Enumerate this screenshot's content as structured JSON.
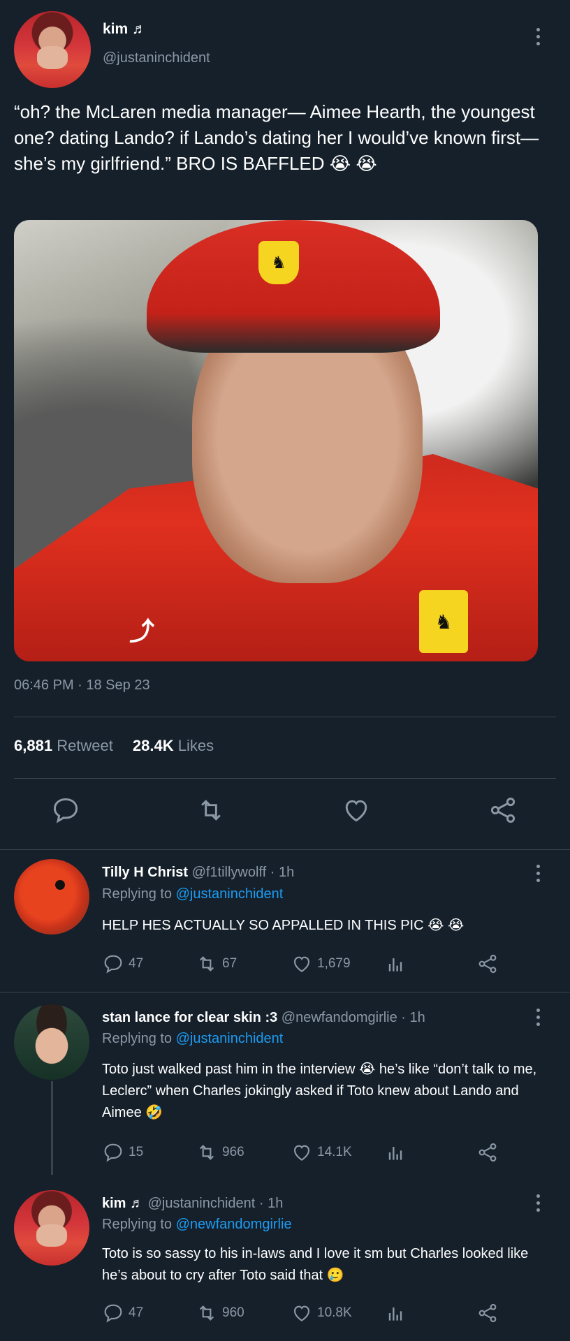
{
  "main_tweet": {
    "display_name": "kim ♬",
    "handle": "@justaninchident",
    "text": "“oh? the McLaren media manager— Aimee Hearth, the youngest one? dating Lando? if Lando’s dating her I would’ve known first— she’s my girlfriend.” BRO IS BAFFLED 😭 😭",
    "timestamp": "06:46 PM · 18 Sep 23",
    "retweets_count": "6,881",
    "retweets_label": "Retweet",
    "likes_count": "28.4K",
    "likes_label": "Likes"
  },
  "replies": [
    {
      "name": "Tilly H Christ",
      "handle_time": "@f1tillywolff · 1h",
      "replying_prefix": "Replying to",
      "replying_to": "@justaninchident",
      "text": "HELP HES ACTUALLY SO APPALLED IN THIS PIC 😭 😭",
      "replies": "47",
      "retweets": "67",
      "likes": "1,679"
    },
    {
      "name": "stan lance for clear skin :3",
      "handle_time": "@newfandomgirlie · 1h",
      "replying_prefix": "Replying to",
      "replying_to": "@justaninchident",
      "text": "Toto just walked past him in the interview 😭  he’s like “don’t talk to me, Leclerc” when Charles jokingly asked if Toto knew about Lando and Aimee 🤣",
      "replies": "15",
      "retweets": "966",
      "likes": "14.1K"
    },
    {
      "name": "kim ♬",
      "handle_time": "@justaninchident · 1h",
      "replying_prefix": "Replying to",
      "replying_to": "@newfandomgirlie",
      "text": "Toto is so sassy to his in-laws and I love it sm but Charles looked like he’s about to cry after Toto said that 🥲",
      "replies": "47",
      "retweets": "960",
      "likes": "10.8K"
    }
  ],
  "icons": {
    "reply": "speech-bubble-icon",
    "retweet": "retweet-icon",
    "like": "heart-icon",
    "share": "share-icon",
    "analytics": "analytics-icon",
    "more": "more-dots-icon"
  },
  "colors": {
    "background": "#15202b",
    "muted": "#8b98a5",
    "link": "#1d9bf0",
    "divider": "#38444d"
  }
}
